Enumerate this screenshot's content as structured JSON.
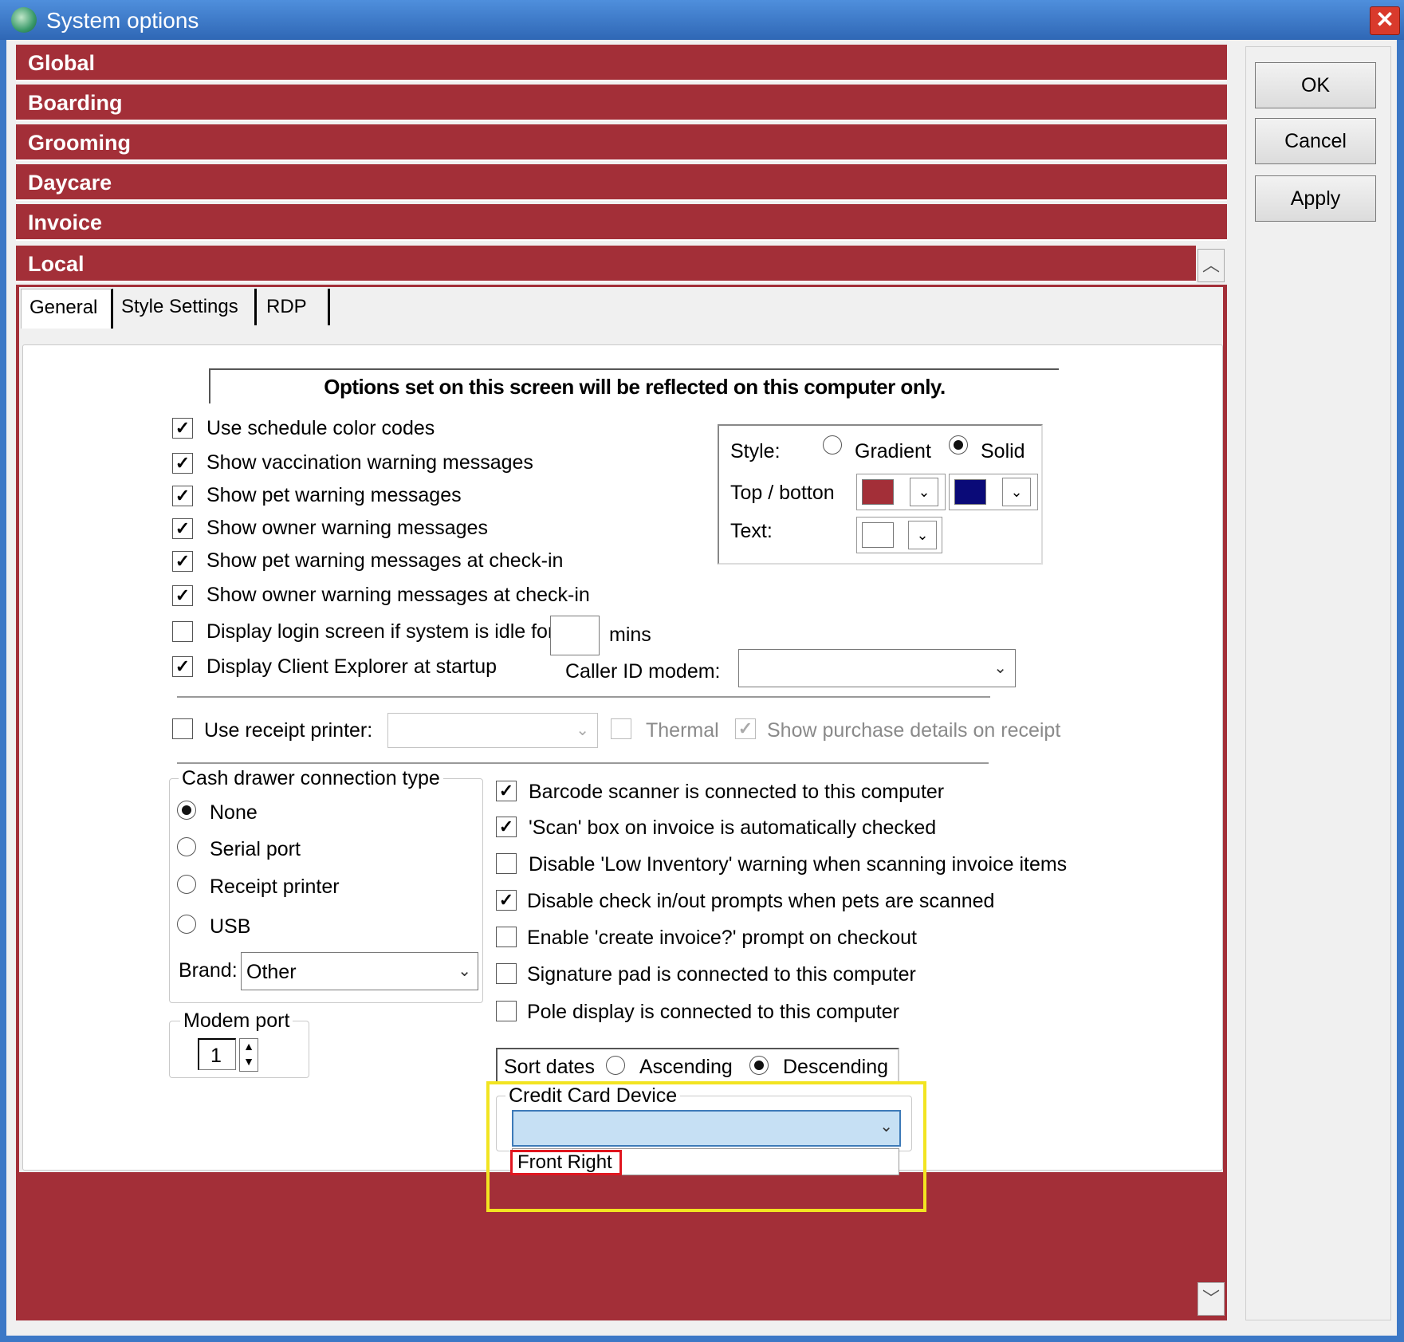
{
  "window": {
    "title": "System options",
    "close_icon": "close-icon"
  },
  "accordion": {
    "items": [
      {
        "label": "Global"
      },
      {
        "label": "Boarding"
      },
      {
        "label": "Grooming"
      },
      {
        "label": "Daycare"
      },
      {
        "label": "Invoice"
      },
      {
        "label": "Local"
      }
    ]
  },
  "tabs": [
    {
      "label": "General",
      "selected": true
    },
    {
      "label": "Style Settings"
    },
    {
      "label": "RDP"
    }
  ],
  "notice": "Options set on this screen will be reflected on this computer only.",
  "options": [
    {
      "label": "Use schedule color codes",
      "checked": true
    },
    {
      "label": "Show vaccination warning messages",
      "checked": true
    },
    {
      "label": "Show pet warning messages",
      "checked": true
    },
    {
      "label": "Show owner warning messages",
      "checked": true
    },
    {
      "label": "Show pet warning messages at check-in",
      "checked": true
    },
    {
      "label": "Show owner warning messages at check-in",
      "checked": true
    },
    {
      "label": "Display login screen if system is idle for",
      "checked": false
    },
    {
      "label": "Display Client Explorer at startup",
      "checked": true
    }
  ],
  "idle": {
    "value": "",
    "unit": "mins"
  },
  "caller_id": {
    "label": "Caller ID modem:",
    "value": ""
  },
  "style": {
    "label": "Style:",
    "gradient_label": "Gradient",
    "solid_label": "Solid",
    "selected": "Solid",
    "top_bottom_label": "Top / botton",
    "text_label": "Text:",
    "top_color": "#a32f38",
    "bottom_color": "#0a0a78",
    "text_color": "#ffffff"
  },
  "receipt": {
    "label": "Use receipt printer:",
    "checked": false,
    "value": "",
    "thermal_label": "Thermal",
    "purchase_label": "Show purchase details on receipt"
  },
  "cash_drawer": {
    "title": "Cash drawer connection type",
    "options": [
      "None",
      "Serial port",
      "Receipt printer",
      "USB"
    ],
    "selected": "None",
    "brand_label": "Brand:",
    "brand_value": "Other"
  },
  "modem_port": {
    "title": "Modem port",
    "value": "1"
  },
  "devices": [
    {
      "label": "Barcode scanner is connected to this computer",
      "checked": true
    },
    {
      "label": "'Scan'  box on invoice is automatically checked",
      "checked": true
    },
    {
      "label": "Disable 'Low Inventory' warning when scanning invoice items",
      "checked": false
    },
    {
      "label": "Disable check in/out prompts when pets are scanned",
      "checked": true
    },
    {
      "label": "Enable 'create invoice?' prompt on checkout",
      "checked": false
    },
    {
      "label": "Signature pad is connected to this computer",
      "checked": false
    },
    {
      "label": "Pole display is connected to this computer",
      "checked": false
    }
  ],
  "sort_dates": {
    "label": "Sort dates",
    "ascending_label": "Ascending",
    "descending_label": "Descending",
    "selected": "Descending"
  },
  "credit_card": {
    "title": "Credit Card Device",
    "value": "",
    "option": "Front Right"
  },
  "buttons": {
    "ok": "OK",
    "cancel": "Cancel",
    "apply": "Apply"
  },
  "colors": {
    "accent": "#a32f38",
    "highlight_box": "#f2e421",
    "selection_box": "#e0161f"
  }
}
